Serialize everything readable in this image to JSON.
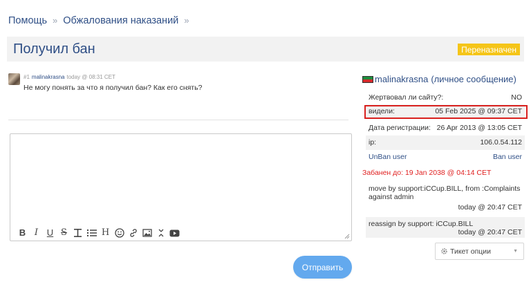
{
  "breadcrumb": {
    "items": [
      "Помощь",
      "Обжалования наказаний"
    ],
    "separator": "»"
  },
  "ticket": {
    "title": "Получил бан",
    "status_badge": "Переназначен"
  },
  "post": {
    "number": "#1",
    "author": "malinakrasna",
    "time": "today @ 08:31 CET",
    "text": "Не могу понять за что я получил бан? Как его снять?"
  },
  "editor": {
    "value": "",
    "toolbar": [
      "bold",
      "italic",
      "underline",
      "strikethrough",
      "align-left",
      "list",
      "heading",
      "emoji",
      "link",
      "image",
      "spoiler",
      "youtube"
    ]
  },
  "send_button": "Отправить",
  "sidebar": {
    "username": "malinakrasna",
    "pm_link": "(личное сообщение)",
    "rows": [
      {
        "key": "Жертвовал ли сайту?:",
        "value": "NO"
      },
      {
        "key": "видели:",
        "value": "05 Feb 2025 @ 09:37 CET"
      },
      {
        "key": "Дата регистрации:",
        "value": "26 Apr 2013 @ 13:05 CET"
      },
      {
        "key": "ip:",
        "value": "106.0.54.112"
      }
    ],
    "unban_link": "UnBan user",
    "ban_link": "Ban user",
    "banned_until": "Забанен до: 19 Jan 2038 @ 04:14 CET",
    "log": [
      {
        "text": "move by support:iCCup.BILL, from :Complaints against admin",
        "time": "today @ 20:47 CET"
      },
      {
        "text": "reassign by support: iCCup.BILL",
        "time": "today @ 20:47 CET"
      }
    ],
    "ticket_options": "Тикет опции"
  },
  "colors": {
    "link": "#2f4f86",
    "badge": "#f5c518",
    "ban_red": "#e02020",
    "highlight_border": "#d9201e",
    "send_button": "#63a9ee"
  }
}
